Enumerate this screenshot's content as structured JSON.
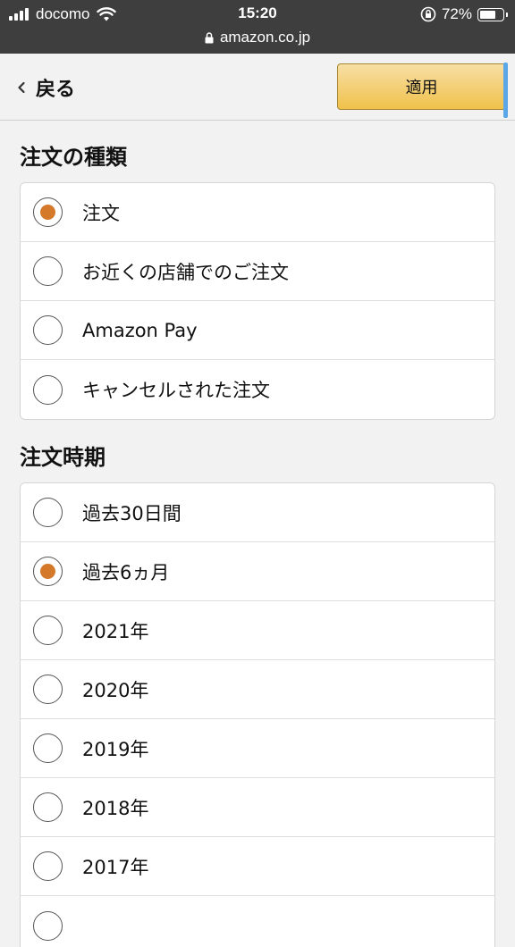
{
  "status_bar": {
    "carrier": "docomo",
    "time": "15:20",
    "battery_percent": "72%",
    "battery_level": 0.72,
    "url": "amazon.co.jp"
  },
  "header": {
    "back_label": "戻る",
    "apply_label": "適用"
  },
  "colors": {
    "accent_radio": "#d4792a",
    "apply_button": "#f0c14b"
  },
  "order_type": {
    "title": "注文の種類",
    "options": [
      {
        "label": "注文",
        "selected": true
      },
      {
        "label": "お近くの店舗でのご注文",
        "selected": false
      },
      {
        "label": "Amazon Pay",
        "selected": false
      },
      {
        "label": "キャンセルされた注文",
        "selected": false
      }
    ]
  },
  "order_period": {
    "title": "注文時期",
    "options": [
      {
        "label": "過去30日間",
        "selected": false
      },
      {
        "label": "過去6ヵ月",
        "selected": true
      },
      {
        "label": "2021年",
        "selected": false
      },
      {
        "label": "2020年",
        "selected": false
      },
      {
        "label": "2019年",
        "selected": false
      },
      {
        "label": "2018年",
        "selected": false
      },
      {
        "label": "2017年",
        "selected": false
      },
      {
        "label": "",
        "selected": false
      }
    ]
  }
}
